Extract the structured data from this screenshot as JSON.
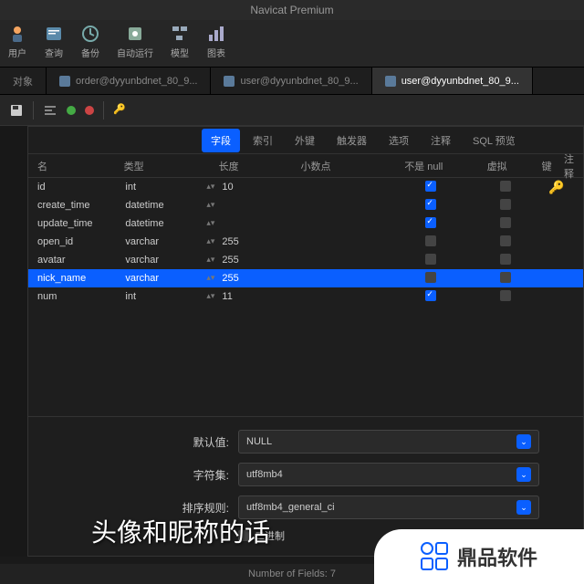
{
  "title": "Navicat Premium",
  "toolbar": [
    {
      "label": "用户",
      "icon": "user"
    },
    {
      "label": "查询",
      "icon": "query"
    },
    {
      "label": "备份",
      "icon": "backup"
    },
    {
      "label": "自动运行",
      "icon": "auto"
    },
    {
      "label": "模型",
      "icon": "model"
    },
    {
      "label": "图表",
      "icon": "chart"
    }
  ],
  "tabs": [
    {
      "label": "对象"
    },
    {
      "label": "order@dyyunbdnet_80_9..."
    },
    {
      "label": "user@dyyunbdnet_80_9..."
    },
    {
      "label": "user@dyyunbdnet_80_9...",
      "active": true
    }
  ],
  "subtabs": [
    "字段",
    "索引",
    "外键",
    "触发器",
    "选项",
    "注释",
    "SQL 预览"
  ],
  "active_subtab": "字段",
  "columns": {
    "name": "名",
    "type": "类型",
    "length": "长度",
    "decimal": "小数点",
    "notnull": "不是 null",
    "virtual": "虚拟",
    "key": "键",
    "comment": "注释"
  },
  "fields": [
    {
      "name": "id",
      "type": "int",
      "len": "10",
      "dec": "",
      "null": true,
      "virt": false,
      "key": true
    },
    {
      "name": "create_time",
      "type": "datetime",
      "len": "",
      "dec": "",
      "null": true,
      "virt": false,
      "key": false
    },
    {
      "name": "update_time",
      "type": "datetime",
      "len": "",
      "dec": "",
      "null": true,
      "virt": false,
      "key": false
    },
    {
      "name": "open_id",
      "type": "varchar",
      "len": "255",
      "dec": "",
      "null": false,
      "virt": false,
      "key": false
    },
    {
      "name": "avatar",
      "type": "varchar",
      "len": "255",
      "dec": "",
      "null": false,
      "virt": false,
      "key": false
    },
    {
      "name": "nick_name",
      "type": "varchar",
      "len": "255",
      "dec": "",
      "null": false,
      "virt": false,
      "key": false,
      "sel": true
    },
    {
      "name": "num",
      "type": "int",
      "len": "11",
      "dec": "",
      "null": true,
      "virt": false,
      "key": false
    }
  ],
  "props": {
    "default_label": "默认值:",
    "default_val": "NULL",
    "charset_label": "字符集:",
    "charset_val": "utf8mb4",
    "collation_label": "排序规则:",
    "collation_val": "utf8mb4_general_ci",
    "binary_label": "二进制"
  },
  "caption": "头像和昵称的话",
  "watermark": "鼎品软件",
  "status": "Number of Fields: 7"
}
